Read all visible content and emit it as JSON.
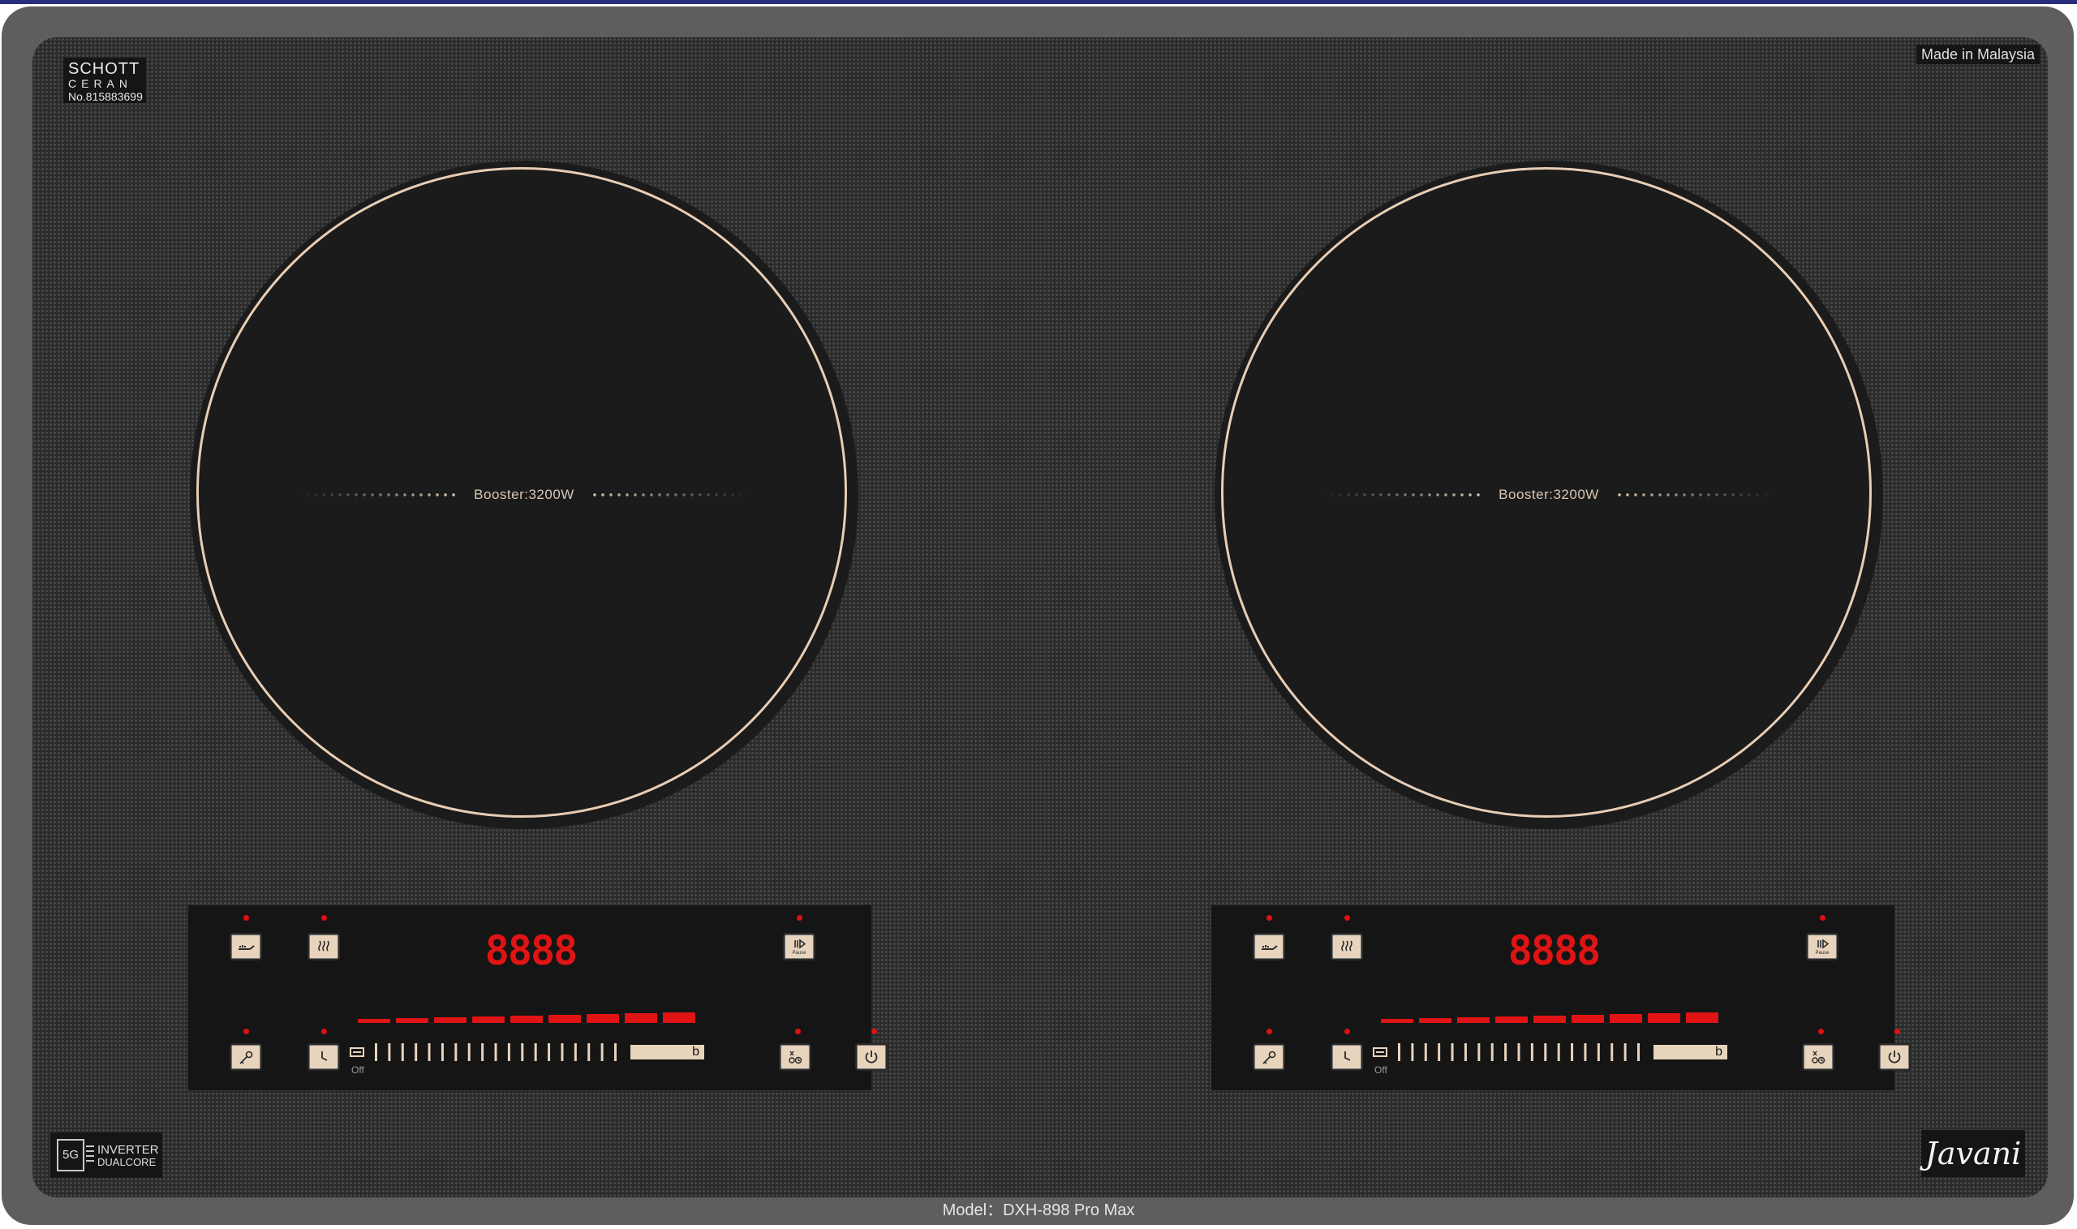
{
  "logo": {
    "line1": "SCHOTT",
    "line2": "CERAN",
    "line3": "No.815883699"
  },
  "made_in": "Made in Malaysia",
  "zones": [
    {
      "booster_label": "Booster:3200W"
    },
    {
      "booster_label": "Booster:3200W"
    }
  ],
  "panels": [
    {
      "display": "8888",
      "pause_label": "Pause",
      "off_label": "Off",
      "boost_key": "b",
      "power_levels": 9
    },
    {
      "display": "8888",
      "pause_label": "Pause",
      "off_label": "Off",
      "boost_key": "b",
      "power_levels": 9
    }
  ],
  "inverter": {
    "chip": "5G",
    "line1": "INVERTER",
    "line2": "DUALCORE"
  },
  "brand": "Javani",
  "model": "Model：DXH-898 Pro Max",
  "colors": {
    "glass": "#2b2b2b",
    "frame": "#5e5e5e",
    "led": "#e01010",
    "key": "#e8d3bd",
    "ring": "#e8cdb4"
  }
}
